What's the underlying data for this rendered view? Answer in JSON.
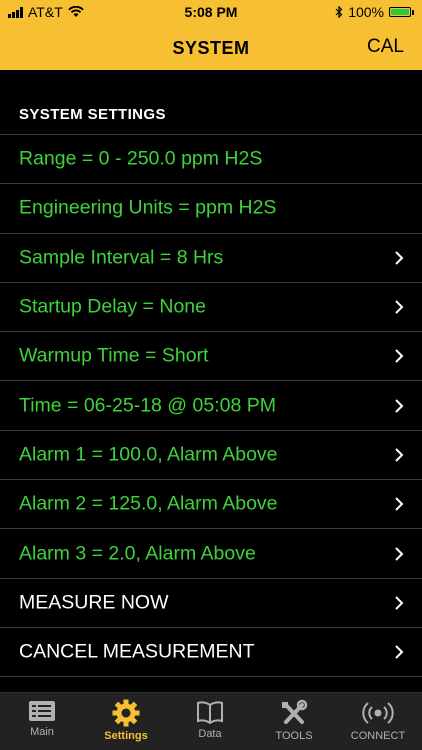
{
  "status_bar": {
    "carrier": "AT&T",
    "time": "5:08 PM",
    "battery": "100%"
  },
  "header": {
    "title": "SYSTEM",
    "right_button": "CAL"
  },
  "section_title": "SYSTEM SETTINGS",
  "settings": [
    {
      "label": "Range = 0 - 250.0 ppm H2S",
      "chevron": false,
      "color": "#3ed23b"
    },
    {
      "label": "Engineering Units = ppm H2S",
      "chevron": false,
      "color": "#3ed23b"
    },
    {
      "label": "Sample Interval = 8 Hrs",
      "chevron": true,
      "color": "#3ed23b"
    },
    {
      "label": "Startup Delay = None",
      "chevron": true,
      "color": "#3ed23b"
    },
    {
      "label": "Warmup Time = Short",
      "chevron": true,
      "color": "#3ed23b"
    },
    {
      "label": "Time = 06-25-18 @ 05:08 PM",
      "chevron": true,
      "color": "#3ed23b"
    },
    {
      "label": "Alarm 1 = 100.0, Alarm Above",
      "chevron": true,
      "color": "#3ed23b"
    },
    {
      "label": "Alarm 2 = 125.0, Alarm Above",
      "chevron": true,
      "color": "#3ed23b"
    },
    {
      "label": "Alarm 3 = 2.0, Alarm Above",
      "chevron": true,
      "color": "#3ed23b"
    },
    {
      "label": "MEASURE NOW",
      "chevron": true,
      "color": "#ffffff"
    },
    {
      "label": "CANCEL MEASUREMENT",
      "chevron": true,
      "color": "#ffffff"
    }
  ],
  "tabs": [
    {
      "label": "Main",
      "icon": "list-icon",
      "active": false
    },
    {
      "label": "Settings",
      "icon": "gear-icon",
      "active": true
    },
    {
      "label": "Data",
      "icon": "book-icon",
      "active": false
    },
    {
      "label": "TOOLS",
      "icon": "tools-icon",
      "active": false
    },
    {
      "label": "CONNECT",
      "icon": "wireless-icon",
      "active": false
    }
  ],
  "colors": {
    "accent": "#f6c032",
    "setting_text": "#3ed23b",
    "background": "#000000"
  }
}
